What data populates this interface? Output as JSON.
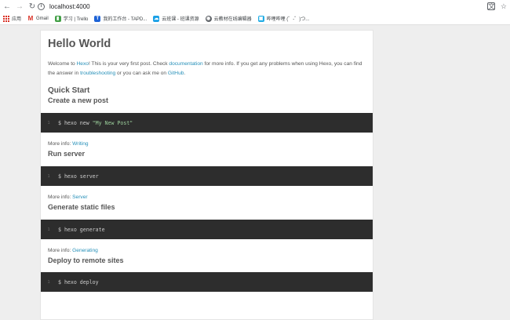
{
  "browser": {
    "url": "localhost:4000",
    "bookmarks": [
      {
        "label": "应用",
        "icon": "apps-grid-icon",
        "color": "#d93025"
      },
      {
        "label": "Gmail",
        "icon": "gmail-icon",
        "color": "#d93025"
      },
      {
        "label": "学习 | Trello",
        "icon": "trello-icon",
        "color": "#43a047"
      },
      {
        "label": "我的工作台 - TAPD...",
        "icon": "tapd-icon",
        "color": "#1e63d6"
      },
      {
        "label": "云班课 - 班课资源",
        "icon": "mosoteach-icon",
        "color": "#1aa0e6"
      },
      {
        "label": "云教材在线编辑器",
        "icon": "globe-icon",
        "color": "#5f6368"
      },
      {
        "label": "哔哩哔哩 (゜-゜)つ...",
        "icon": "bilibili-icon",
        "color": "#23ade5"
      }
    ]
  },
  "post": {
    "title": "Hello World",
    "intro": {
      "t1": "Welcome to ",
      "link_hexo": "Hexo",
      "t2": "! This is your very first post. Check ",
      "link_docs": "documentation",
      "t3": " for more info. If you get any problems when using Hexo, you can find the answer in ",
      "link_troubleshooting": "troubleshooting",
      "t4": " or you can ask me on ",
      "link_github": "GitHub",
      "t5": "."
    },
    "quick_start": "Quick Start",
    "more_info_prefix": "More info: ",
    "sections": [
      {
        "title": "Create a new post",
        "line": "1",
        "code": "$ hexo new ",
        "code_str": "\"My New Post\"",
        "more_link": "Writing"
      },
      {
        "title": "Run server",
        "line": "1",
        "code": "$ hexo server",
        "code_str": "",
        "more_link": "Server"
      },
      {
        "title": "Generate static files",
        "line": "1",
        "code": "$ hexo generate",
        "code_str": "",
        "more_link": "Generating"
      },
      {
        "title": "Deploy to remote sites",
        "line": "1",
        "code": "$ hexo deploy",
        "code_str": ""
      }
    ]
  },
  "colors": {
    "link": "#258fb8",
    "code_bg": "#2d2d2d",
    "page_bg": "#eeeeee"
  }
}
